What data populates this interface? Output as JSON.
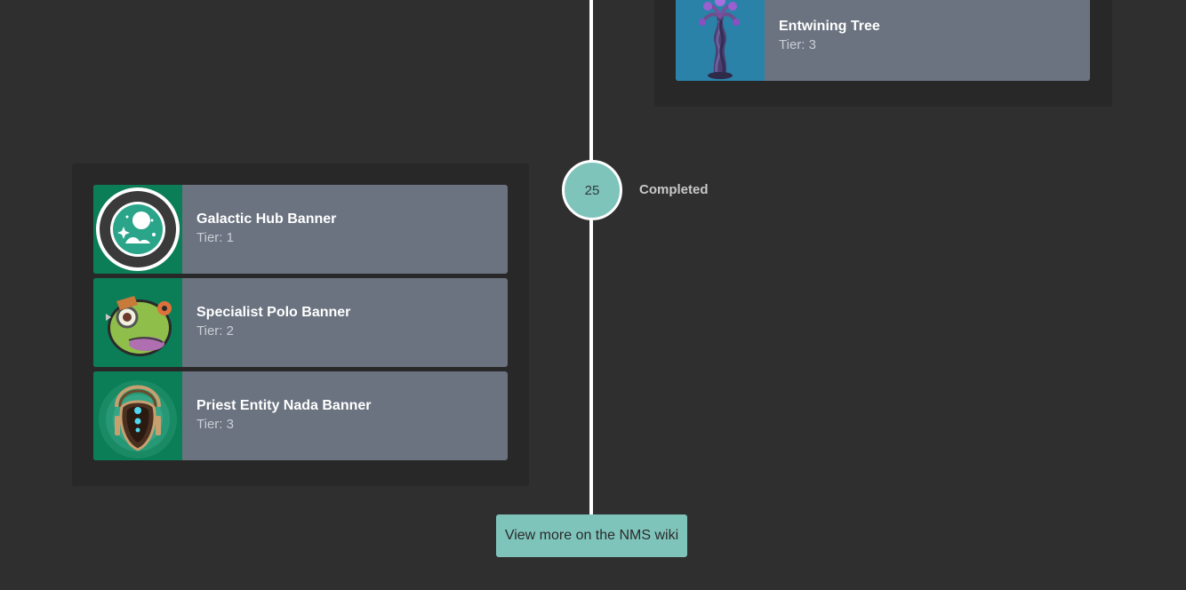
{
  "colors": {
    "background": "#2f2f2f",
    "group_bg": "#282828",
    "card_bg": "#6b7380",
    "accent": "#7fc4bb",
    "timeline": "#ffffff",
    "thumb_green": "#0b7e57",
    "thumb_blue": "#2a82a8"
  },
  "rewards_upper": {
    "items": [
      {
        "name": "Entwining Tree",
        "tier": "Tier: 3",
        "icon": "entwining-tree-image"
      }
    ]
  },
  "milestone": {
    "number": "25",
    "status": "Completed"
  },
  "rewards_lower": {
    "items": [
      {
        "name": "Galactic Hub Banner",
        "tier": "Tier: 1",
        "icon": "galactic-hub-emblem"
      },
      {
        "name": "Specialist Polo Banner",
        "tier": "Tier: 2",
        "icon": "polo-portrait"
      },
      {
        "name": "Priest Entity Nada Banner",
        "tier": "Tier: 3",
        "icon": "nada-portrait"
      }
    ]
  },
  "wiki_button": {
    "label": "View more on the NMS wiki"
  }
}
